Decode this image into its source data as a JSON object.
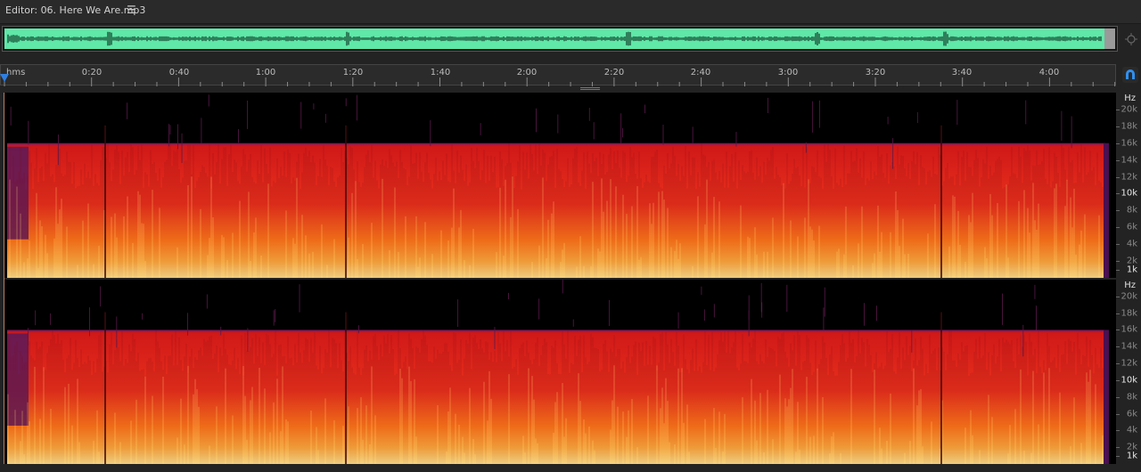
{
  "editor": {
    "title": "Editor: 06. Here We Are.mp3",
    "menu_icon": "hamburger-menu-icon"
  },
  "overview": {
    "waveform_color": "#5fe8a8",
    "zoom_icon": "zoom-navigator-icon"
  },
  "timeline": {
    "unit": "hms",
    "labels": [
      "0:20",
      "0:40",
      "1:00",
      "1:20",
      "1:40",
      "2:00",
      "2:20",
      "2:40",
      "3:00",
      "3:20",
      "3:40",
      "4:00"
    ],
    "playhead_color": "#2f7fe0",
    "snap_icon": "snap-magnet-icon"
  },
  "channels": [
    {
      "name": "top",
      "freq_unit": "Hz",
      "freq_labels": [
        "20k",
        "18k",
        "16k",
        "14k",
        "12k",
        "10k",
        "8k",
        "6k",
        "4k",
        "2k",
        "1k"
      ],
      "bright_labels": [
        "10k",
        "1k"
      ]
    },
    {
      "name": "bottom",
      "freq_unit": "Hz",
      "freq_labels": [
        "20k",
        "18k",
        "16k",
        "14k",
        "12k",
        "10k",
        "8k",
        "6k",
        "4k",
        "2k",
        "1k"
      ],
      "bright_labels": [
        "10k",
        "1k"
      ]
    }
  ],
  "spectrogram": {
    "max_freq_khz": 22,
    "cutoff_khz": 16,
    "colors": {
      "low": "#ffe890",
      "mid": "#ff7a1a",
      "high": "#d01818",
      "edge": "#6a1a6a",
      "background": "#000000"
    }
  }
}
